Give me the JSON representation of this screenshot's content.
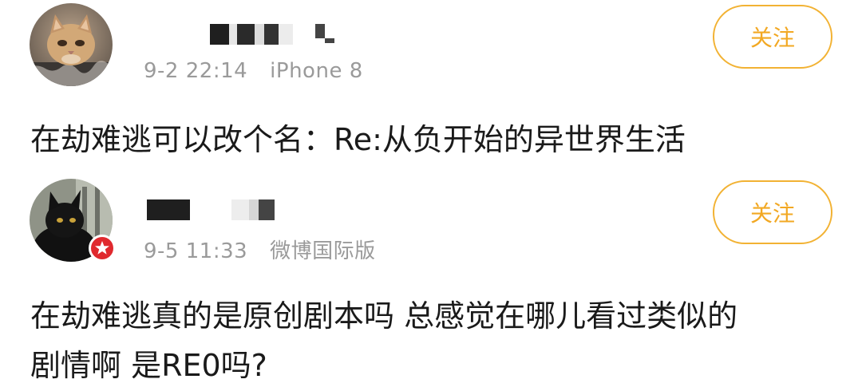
{
  "posts": [
    {
      "time": "9-2 22:14",
      "source": "iPhone 8",
      "follow_label": "关注",
      "text": "在劫难逃可以改个名：Re:从负开始的异世界生活",
      "avatar_icon": "cat-avatar-icon",
      "accent": "#f2b233"
    },
    {
      "time": "9-5 11:33",
      "source": "微博国际版",
      "follow_label": "关注",
      "text": "在劫难逃真的是原创剧本吗 总感觉在哪儿看过类似的\n剧情啊 是RE0吗?",
      "avatar_icon": "black-cat-avatar-icon",
      "badge_icon": "verified-star-badge-icon",
      "accent": "#f2b233"
    }
  ]
}
